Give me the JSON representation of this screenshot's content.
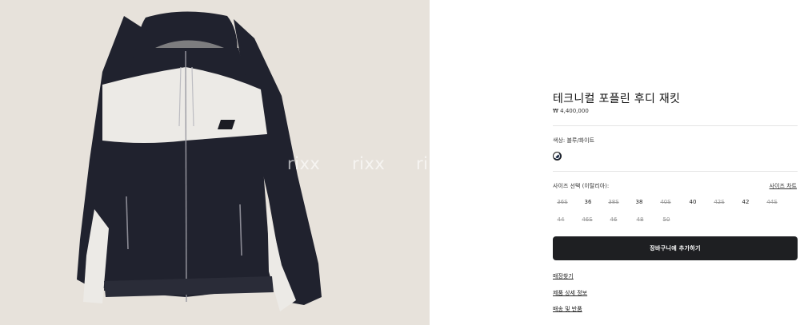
{
  "product": {
    "title": "테크니컬 포플린 후디 재킷",
    "price": "₩ 4,400,000",
    "image_alt": "product-photo-hooded-jacket",
    "jacket_logo_text": "miu miu"
  },
  "watermarks": [
    "rixx",
    "rixx",
    "ri"
  ],
  "color": {
    "label": "색상:",
    "value": "블루/화이트",
    "swatch_colors": [
      "#ffffff",
      "#1c2a44"
    ]
  },
  "sizes": {
    "label": "사이즈 선택 (이탈리아):",
    "chart_link": "사이즈 차트",
    "rows": [
      [
        {
          "label": "36S",
          "available": false
        },
        {
          "label": "36",
          "available": true
        },
        {
          "label": "38S",
          "available": false
        },
        {
          "label": "38",
          "available": true
        },
        {
          "label": "40S",
          "available": false
        },
        {
          "label": "40",
          "available": true
        },
        {
          "label": "42S",
          "available": false
        },
        {
          "label": "42",
          "available": true
        },
        {
          "label": "44S",
          "available": false
        }
      ],
      [
        {
          "label": "44",
          "available": false
        },
        {
          "label": "46S",
          "available": false
        },
        {
          "label": "46",
          "available": false
        },
        {
          "label": "48",
          "available": false
        },
        {
          "label": "50",
          "available": false
        }
      ]
    ]
  },
  "actions": {
    "add_to_cart": "장바구니에 추가하기"
  },
  "links": {
    "store": "매장찾기",
    "details": "제품 상세 정보",
    "shipping": "배송 및 반품"
  },
  "colors": {
    "background_left": "#e7e2db",
    "button": "#1e1f22",
    "jacket_navy": "#20222e",
    "jacket_white": "#eceae6"
  }
}
